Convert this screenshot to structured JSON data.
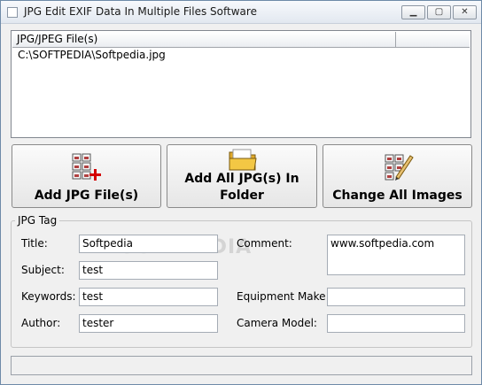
{
  "window": {
    "title": "JPG Edit EXIF Data In Multiple Files Software",
    "min_glyph": "▁",
    "max_glyph": "▢",
    "close_glyph": "✕"
  },
  "file_list": {
    "column_header": "JPG/JPEG File(s)",
    "rows": [
      "C:\\SOFTPEDIA\\Softpedia.jpg"
    ]
  },
  "buttons": {
    "add_file": "Add JPG File(s)",
    "add_folder_line1": "Add All JPG(s) In",
    "add_folder_line2": "Folder",
    "change_all": "Change All Images"
  },
  "tag_group": {
    "legend": "JPG Tag",
    "title_label": "Title:",
    "title_value": "Softpedia",
    "subject_label": "Subject:",
    "subject_value": "test",
    "keywords_label": "Keywords:",
    "keywords_value": "test",
    "author_label": "Author:",
    "author_value": "tester",
    "comment_label": "Comment:",
    "comment_value": "www.softpedia.com",
    "equipment_label": "Equipment Make:",
    "equipment_value": "",
    "camera_label": "Camera Model:",
    "camera_value": ""
  },
  "watermark": "SOFTPEDIA",
  "status": "",
  "icons": {
    "add_file": "image-grid-add-icon",
    "add_folder": "folder-icon",
    "change_all": "image-edit-icon"
  },
  "colors": {
    "window_bg": "#f0f0f0",
    "field_border": "#a5acb5",
    "add_plus": "#d40000",
    "folder": "#f3c744"
  }
}
